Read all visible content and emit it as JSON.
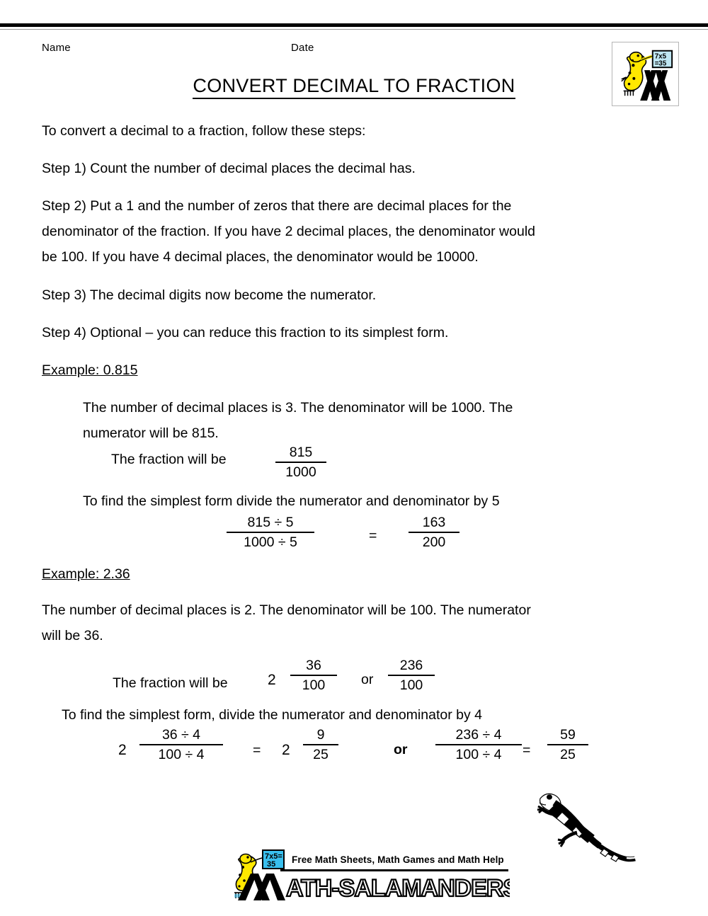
{
  "header": {
    "name_label": "Name",
    "date_label": "Date",
    "title": "CONVERT DECIMAL TO FRACTION",
    "logo_board_line1": "7x5",
    "logo_board_line2": "=35"
  },
  "intro": "To convert a decimal to a fraction, follow these steps:",
  "steps": [
    "Step 1) Count the number of decimal places the decimal has.",
    "Step 2) Put a 1 and the number of zeros that there are decimal places for the\ndenominator of the fraction. If you have 2 decimal places, the denominator would\nbe 100. If you have 4 decimal places, the denominator would be 10000.",
    "Step 3) The decimal digits now become the numerator.",
    "Step 4) Optional – you can reduce this fraction to its simplest form."
  ],
  "example1": {
    "heading": "Example: 0.815",
    "explanation": "The number of decimal places is 3. The denominator will be 1000. The\nnumerator will be 815.",
    "fraction_lead": "The fraction will be",
    "fraction": {
      "numerator": "815",
      "denominator": "1000"
    },
    "simplify_text": "To find the simplest form divide the numerator and denominator by 5",
    "equation": {
      "left": {
        "numerator": "815 ÷ 5",
        "denominator": "1000 ÷ 5"
      },
      "equals": "=",
      "right": {
        "numerator": "163",
        "denominator": "200"
      }
    }
  },
  "example2": {
    "heading": "Example: 2.36",
    "explanation": "The number of decimal places is 2. The denominator will be 100. The numerator\nwill be 36.",
    "fraction_lead": "The fraction will be",
    "mixed_whole": "2",
    "fraction_a": {
      "numerator": "36",
      "denominator": "100"
    },
    "or_label": "or",
    "fraction_b": {
      "numerator": "236",
      "denominator": "100"
    },
    "simplify_text": "To find the simplest form, divide the numerator and denominator by 4",
    "equation": {
      "left_whole": "2",
      "left": {
        "numerator": "36 ÷ 4",
        "denominator": "100 ÷ 4"
      },
      "equals1": "=",
      "mid_whole": "2",
      "mid": {
        "numerator": "9",
        "denominator": "25"
      },
      "or_label": "or",
      "right_left": {
        "numerator": "236 ÷ 4",
        "denominator": "100 ÷ 4"
      },
      "equals2": "=",
      "right": {
        "numerator": "59",
        "denominator": "25"
      }
    }
  },
  "footer": {
    "tagline": "Free Math Sheets, Math Games and Math Help",
    "wordmark": "ATH-SALAMANDERS.COM",
    "logo_board_line1": "7x5=",
    "logo_board_line2": "35"
  },
  "colors": {
    "salamander_yellow": "#FFE800",
    "board_blue": "#39BFEE",
    "board_blue_light": "#BFE6F2",
    "ink": "#000000",
    "rule_gray": "#9A9A9A"
  }
}
